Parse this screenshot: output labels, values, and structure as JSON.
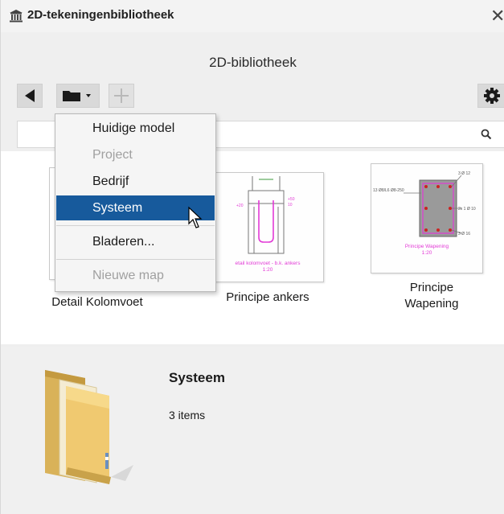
{
  "window": {
    "title": "2D-tekeningenbibliotheek",
    "close_symbol": "✕"
  },
  "library_title": "2D-bibliotheek",
  "toolbar": {
    "back_icon": "triangle-left-icon",
    "folder_icon": "folder-dropdown-icon",
    "add_icon": "plus-icon",
    "settings_icon": "gear-icon"
  },
  "search": {
    "value": "",
    "placeholder": ""
  },
  "menu": {
    "items": [
      {
        "label": "Huidige model",
        "enabled": true
      },
      {
        "label": "Project",
        "enabled": false
      },
      {
        "label": "Bedrijf",
        "enabled": true
      },
      {
        "label": "Systeem",
        "enabled": true,
        "selected": true
      },
      {
        "label": "Bladeren...",
        "enabled": true
      },
      {
        "label": "Nieuwe map",
        "enabled": false
      }
    ]
  },
  "items": [
    {
      "label": "Detail Kolomvoet"
    },
    {
      "label": "Principe ankers",
      "thumb_lines": [
        "etail kolomvoet - b.k. ankers",
        "1:20"
      ],
      "thumb_dims": [
        "+20",
        "+50",
        "10"
      ]
    },
    {
      "label_lines": [
        "Principe",
        "Wapening"
      ],
      "thumb_lines": [
        "Principe Wapening",
        "1:20"
      ],
      "thumb_dims": [
        "3 Ø 12",
        "13 Ø8/L6 Ø8-250",
        "2x 1 Ø 10",
        "3 Ø 16"
      ]
    }
  ],
  "details": {
    "name": "Systeem",
    "count": "3 items"
  },
  "colors": {
    "selection": "#175a9c",
    "magenta": "#e23ad6",
    "folder": "#f0c970"
  }
}
